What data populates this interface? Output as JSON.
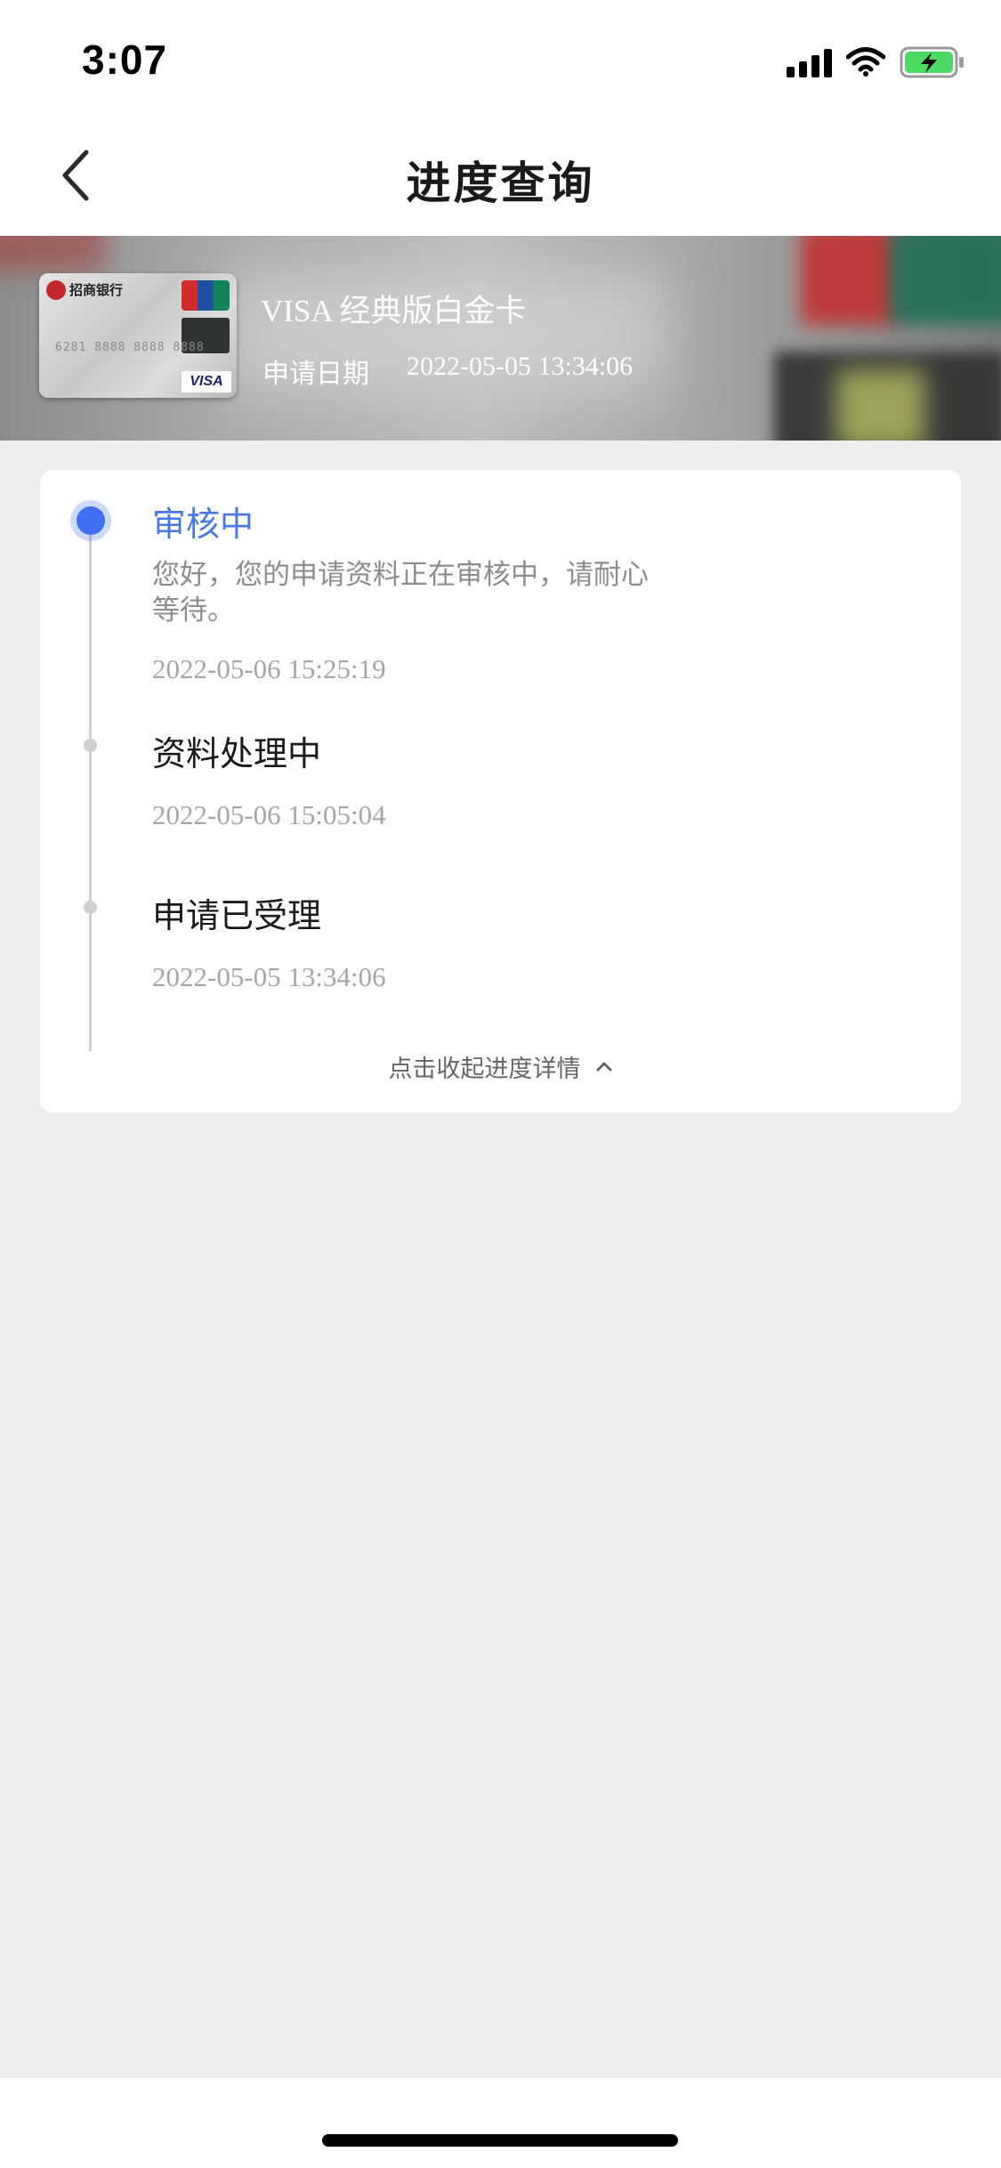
{
  "status_bar": {
    "time": "3:07",
    "icons": [
      "signal-icon",
      "wifi-icon",
      "battery-charging-icon"
    ],
    "battery_color": "#4cd964"
  },
  "nav": {
    "title": "进度查询",
    "back_icon": "chevron-left-icon"
  },
  "card": {
    "name": "VISA 经典版白金卡",
    "date_label": "申请日期",
    "date_value": "2022-05-05 13:34:06",
    "thumbnail": {
      "bank_name": "招商银行",
      "number": "6281 8888 8888 8888",
      "network": "VISA"
    }
  },
  "timeline": {
    "accent_color": "#4a79e6",
    "steps": [
      {
        "title": "审核中",
        "description": "您好，您的申请资料正在审核中，请耐心等待。",
        "time": "2022-05-06 15:25:19",
        "active": true
      },
      {
        "title": "资料处理中",
        "time": "2022-05-06 15:05:04",
        "active": false
      },
      {
        "title": "申请已受理",
        "time": "2022-05-05 13:34:06",
        "active": false
      }
    ],
    "collapse_label": "点击收起进度详情"
  }
}
